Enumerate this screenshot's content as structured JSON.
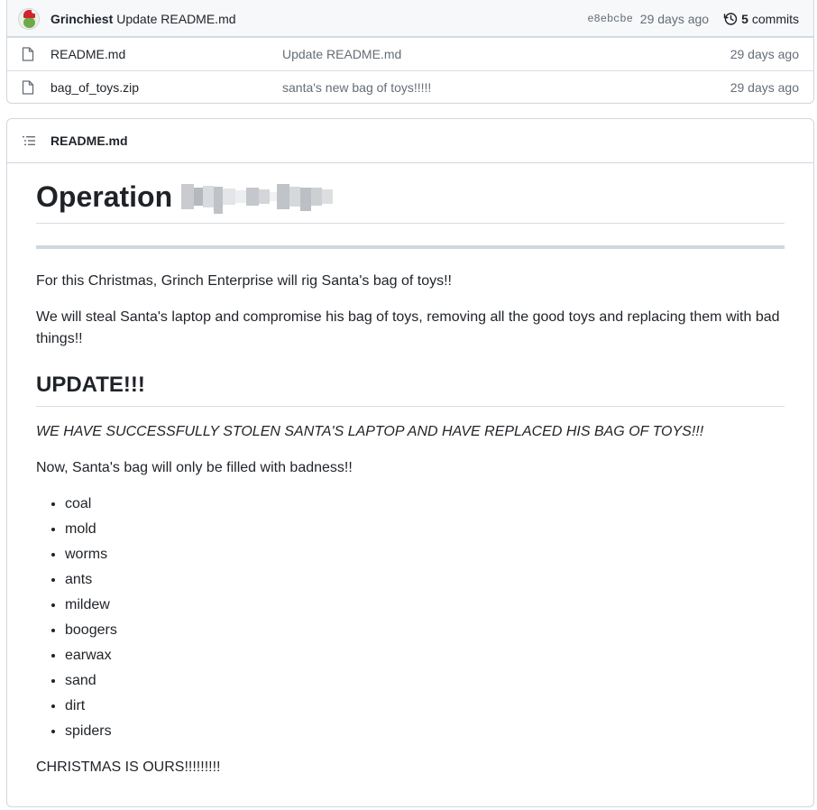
{
  "latest_commit": {
    "author": "Grinchiest",
    "message": "Update README.md",
    "sha": "e8ebcbe",
    "age": "29 days ago",
    "commit_count": "5",
    "commits_label": "commits"
  },
  "files": [
    {
      "name": "README.md",
      "commit_message": "Update README.md",
      "age": "29 days ago",
      "icon": "file-icon"
    },
    {
      "name": "bag_of_toys.zip",
      "commit_message": "santa's new bag of toys!!!!!",
      "age": "29 days ago",
      "icon": "file-icon"
    }
  ],
  "readme": {
    "header_title": "README.md",
    "h1": "Operation",
    "intro": "For this Christmas, Grinch Enterprise will rig Santa's bag of toys!!",
    "plan": "We will steal Santa's laptop and compromise his bag of toys, removing all the good toys and replacing them with bad things!!",
    "update_heading": "UPDATE!!!",
    "update_italic": "WE HAVE SUCCESSFULLY STOLEN SANTA'S LAPTOP AND HAVE REPLACED HIS BAG OF TOYS!!!",
    "now_text": "Now, Santa's bag will only be filled with badness!!",
    "items": [
      "coal",
      "mold",
      "worms",
      "ants",
      "mildew",
      "boogers",
      "earwax",
      "sand",
      "dirt",
      "spiders"
    ],
    "closing": "CHRISTMAS IS OURS!!!!!!!!!"
  },
  "colors": {
    "border": "#d0d7de",
    "muted_text": "#656d76",
    "header_bg": "#f6f8fa"
  }
}
